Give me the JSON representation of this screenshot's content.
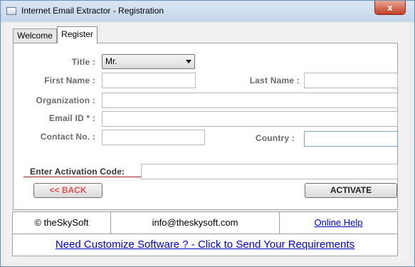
{
  "window": {
    "title": "Internet Email Extractor - Registration",
    "close_glyph": "x"
  },
  "tabs": [
    {
      "label": "Welcome"
    },
    {
      "label": "Register"
    }
  ],
  "form": {
    "title_label": "Title :",
    "title_value": "Mr.",
    "first_name_label": "First Name :",
    "first_name_value": "",
    "last_name_label": "Last Name :",
    "last_name_value": "",
    "organization_label": "Organization :",
    "organization_value": "",
    "email_label": "Email ID * :",
    "email_value": "",
    "contact_label": "Contact No. :",
    "contact_value": "",
    "country_label": "Country :",
    "country_value": "",
    "activation_label": "Enter Activation Code:",
    "activation_value": ""
  },
  "buttons": {
    "back": "<< BACK",
    "activate": "ACTIVATE"
  },
  "footer": {
    "copyright": "© theSkySoft",
    "email": "info@theskysoft.com",
    "online_help": "Online Help",
    "customize_link": "Need Customize Software ? - Click to Send Your Requirements"
  },
  "colors": {
    "accent_link": "#0000cc",
    "back_button_text": "#d9534f",
    "divider": "#9a2a2a",
    "close_button": "#c4402a"
  }
}
